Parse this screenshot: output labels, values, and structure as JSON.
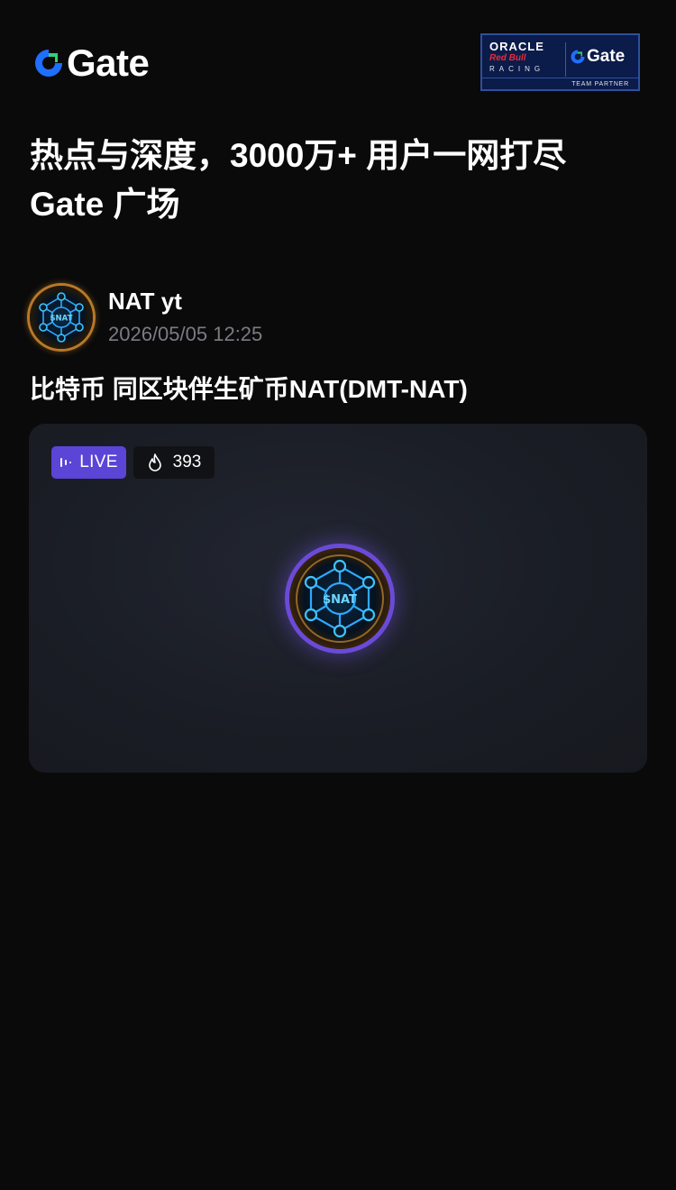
{
  "header": {
    "brand_name": "Gate",
    "partner_badge": {
      "oracle": "ORACLE",
      "red_bull": "Red Bull",
      "racing": "RACING",
      "gate": "Gate",
      "partner": "TEAM PARTNER"
    }
  },
  "headline": {
    "line1": "热点与深度，3000万+ 用户一网打尽",
    "line2": "Gate 广场"
  },
  "post": {
    "author_name": "NAT yt",
    "timestamp": "2026/05/05 12:25",
    "title": "比特币 同区块伴生矿币NAT(DMT-NAT)",
    "avatar_label": "$NAT"
  },
  "live": {
    "status_label": "LIVE",
    "viewer_count": "393",
    "host_avatar_label": "$NAT"
  },
  "colors": {
    "background": "#0a0a0b",
    "live_badge": "#5a45d6",
    "card": "#1c1f27",
    "muted_text": "#7b7b83",
    "gate_blue": "#1f6fff",
    "gate_green": "#2fd27a"
  },
  "icons": [
    "gate-logo-icon",
    "sound-wave-icon",
    "flame-icon"
  ]
}
